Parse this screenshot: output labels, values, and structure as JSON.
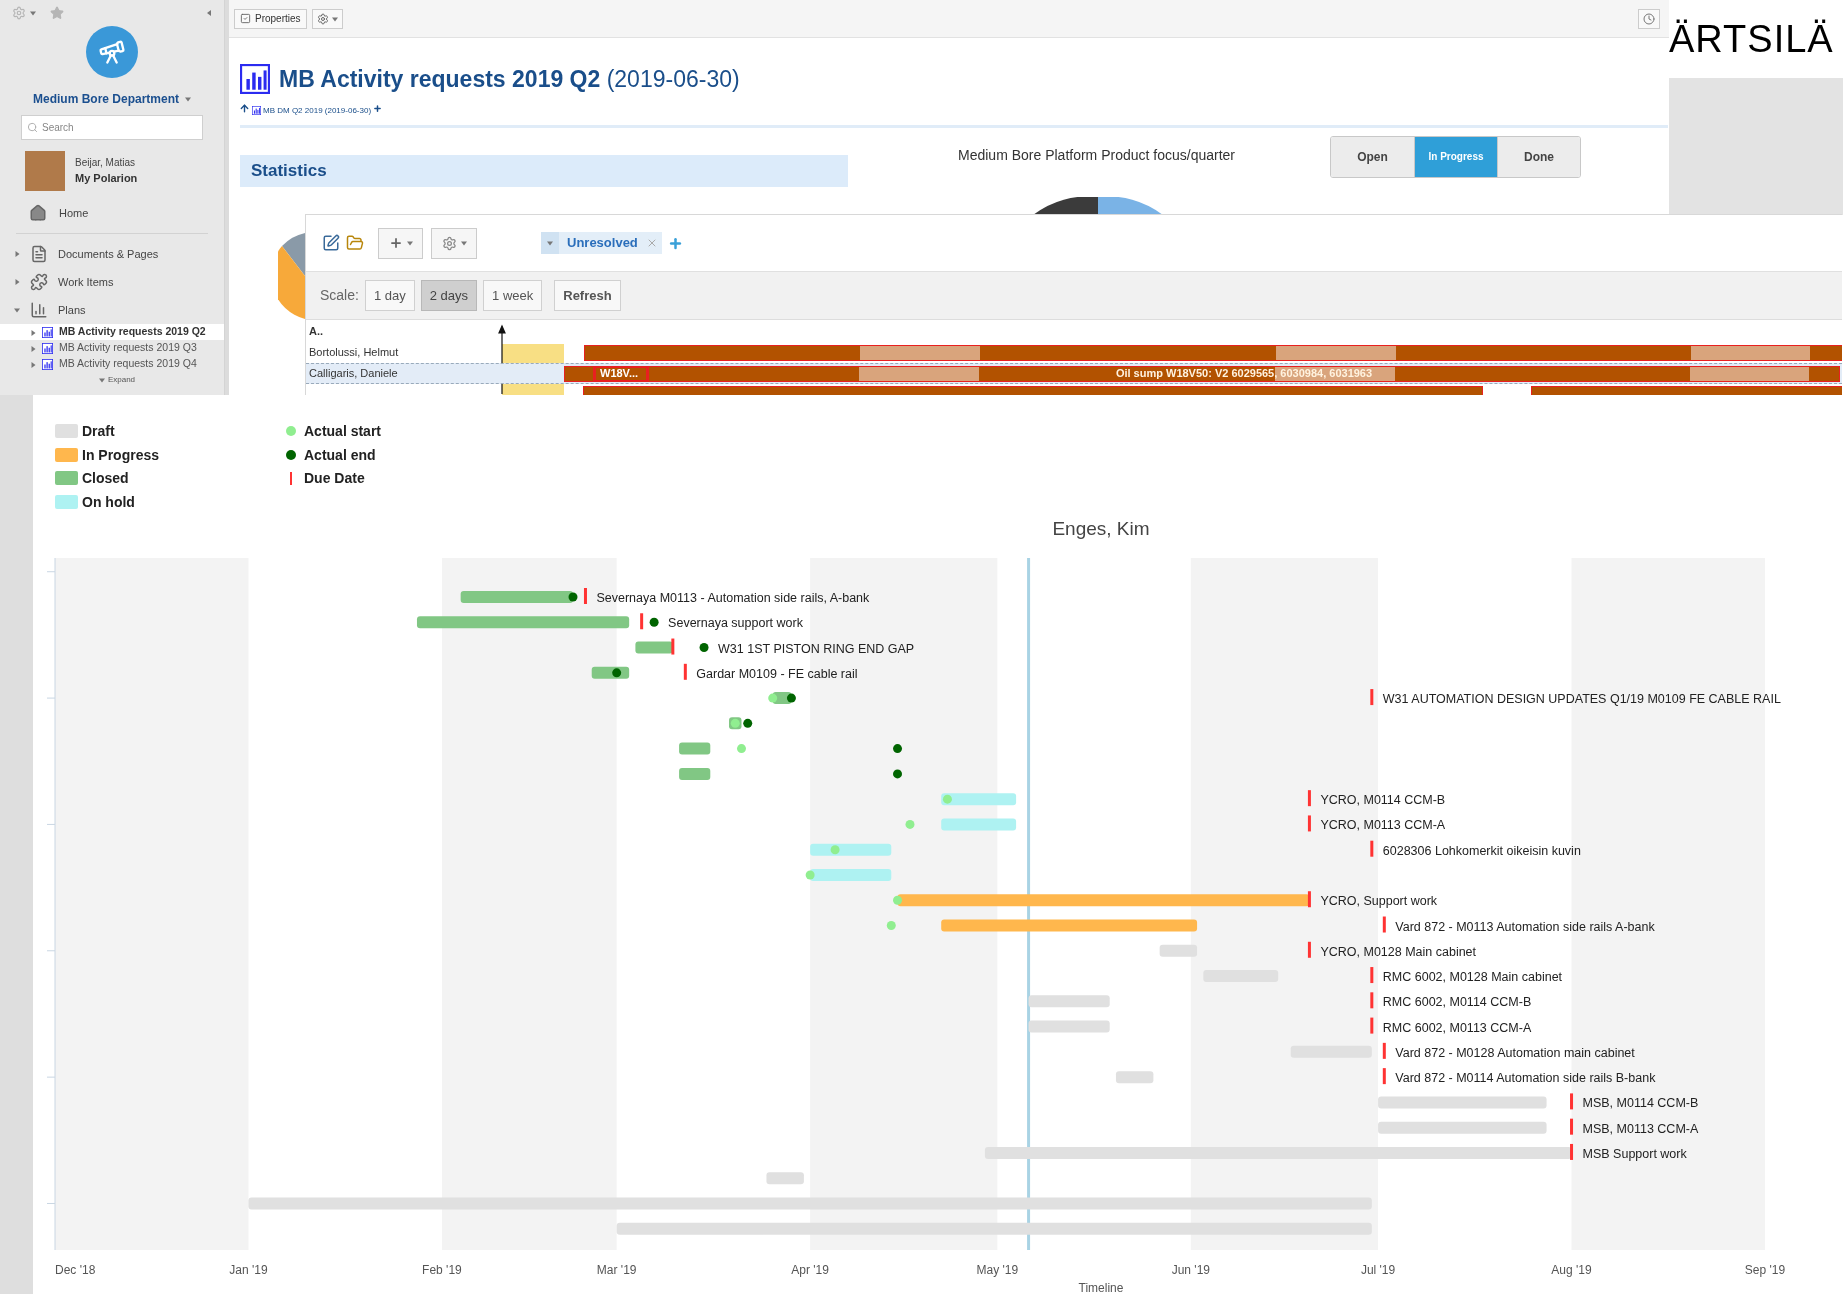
{
  "sidebar": {
    "project": "Medium Bore Department",
    "search": {
      "placeholder": "Search"
    },
    "user": {
      "name": "Beijar, Matias",
      "link": "My Polarion"
    },
    "home": "Home",
    "nav": [
      {
        "label": "Documents & Pages",
        "expanded": false
      },
      {
        "label": "Work Items",
        "expanded": false
      },
      {
        "label": "Plans",
        "expanded": true,
        "children": [
          {
            "label": "MB Activity requests 2019 Q2",
            "selected": true
          },
          {
            "label": "MB Activity requests 2019 Q3",
            "selected": false
          },
          {
            "label": "MB Activity requests 2019 Q4",
            "selected": false
          }
        ]
      }
    ],
    "expand": "Expand"
  },
  "toolbar": {
    "properties": "Properties"
  },
  "logo": "ÄRTSILÄ",
  "header": {
    "title": "MB Activity requests 2019 Q2",
    "title_date": "(2019-06-30)",
    "breadcrumb": "MB DM Q2 2019 (2019-06-30)"
  },
  "statistics": "Statistics",
  "chart_title": "Medium Bore Platform Product focus/quarter",
  "segments": [
    {
      "label": "Open",
      "selected": false
    },
    {
      "label": "In Progress",
      "selected": true
    },
    {
      "label": "Done",
      "selected": false
    }
  ],
  "gantt": {
    "filter": "Unresolved",
    "scale_label": "Scale:",
    "scales": [
      {
        "label": "1 day",
        "selected": false
      },
      {
        "label": "2 days",
        "selected": true
      },
      {
        "label": "1 week",
        "selected": false
      }
    ],
    "refresh": "Refresh",
    "column_header": "A..",
    "rows": [
      {
        "name": "Bortolussi, Helmut",
        "selected": false
      },
      {
        "name": "Calligaris, Daniele",
        "selected": true,
        "bars": [
          "W18V...",
          "Oil sump W18V50: V2 6029565, 6030984, 6031963"
        ]
      }
    ]
  },
  "legend": [
    {
      "label": "Draft",
      "kind": "draft",
      "color": "#e0e0e0"
    },
    {
      "label": "In Progress",
      "kind": "in_progress",
      "color": "#ffb74d"
    },
    {
      "label": "Closed",
      "kind": "closed",
      "color": "#81c784"
    },
    {
      "label": "On hold",
      "kind": "on_hold",
      "color": "#aef2f2"
    }
  ],
  "markers": [
    {
      "label": "Actual start",
      "kind": "actual_start",
      "color": "#90ee90"
    },
    {
      "label": "Actual end",
      "kind": "actual_end",
      "color": "#006400"
    },
    {
      "label": "Due Date",
      "kind": "due",
      "color": "#ff3333"
    }
  ],
  "timeline": {
    "title": "Enges, Kim",
    "xlabel": "Timeline",
    "ticks": [
      "Dec '18",
      "Jan '19",
      "Feb '19",
      "Mar '19",
      "Apr '19",
      "May '19",
      "Jun '19",
      "Jul '19",
      "Aug '19",
      "Sep '19"
    ],
    "tasks": [
      {
        "kind": "closed",
        "label": "Severnaya M0113 - Automation side rails, A-bank"
      },
      {
        "kind": "closed",
        "label": "Severnaya support work"
      },
      {
        "kind": "closed",
        "label": "W31 1ST PISTON RING END GAP"
      },
      {
        "kind": "closed",
        "label": "Gardar M0109 - FE cable rail"
      },
      {
        "kind": "closed",
        "label": "W31 AUTOMATION DESIGN UPDATES Q1/19 M0109 FE CABLE RAIL"
      },
      {
        "kind": "closed"
      },
      {
        "kind": "closed"
      },
      {
        "kind": "closed"
      },
      {
        "kind": "on_hold",
        "label": "YCRO, M0114 CCM-B"
      },
      {
        "kind": "on_hold",
        "label": "YCRO, M0113 CCM-A"
      },
      {
        "kind": "on_hold",
        "label": "6028306 Lohkomerkit oikeisin kuvin"
      },
      {
        "kind": "on_hold"
      },
      {
        "kind": "in_progress",
        "label": "YCRO, Support work"
      },
      {
        "kind": "in_progress",
        "label": "Vard 872 - M0113 Automation side rails A-bank"
      },
      {
        "kind": "draft",
        "label": "YCRO, M0128 Main cabinet"
      },
      {
        "kind": "draft",
        "label": "RMC 6002, M0128 Main cabinet"
      },
      {
        "kind": "draft",
        "label": "RMC 6002, M0114 CCM-B"
      },
      {
        "kind": "draft",
        "label": "RMC 6002, M0113 CCM-A"
      },
      {
        "kind": "draft",
        "label": "Vard 872 - M0128 Automation main cabinet"
      },
      {
        "kind": "draft",
        "label": "Vard 872 - M0114 Automation side rails B-bank"
      },
      {
        "kind": "draft",
        "label": "MSB, M0114 CCM-B"
      },
      {
        "kind": "draft",
        "label": "MSB, M0113 CCM-A"
      },
      {
        "kind": "draft",
        "label": "MSB Support work"
      },
      {
        "kind": "draft"
      },
      {
        "kind": "draft"
      },
      {
        "kind": "draft"
      }
    ]
  }
}
